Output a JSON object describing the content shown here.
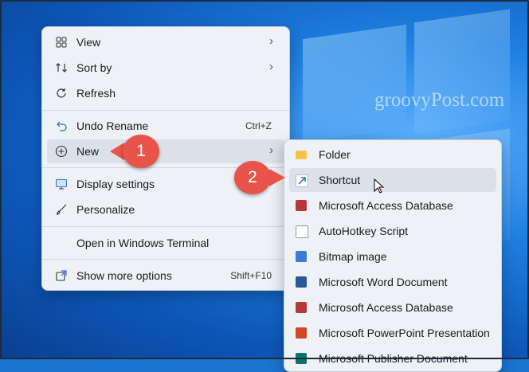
{
  "watermark": "groovyPost.com",
  "context_menu": {
    "items": [
      {
        "label": "View",
        "icon": "grid-icon",
        "chevron": "›"
      },
      {
        "label": "Sort by",
        "icon": "sort-icon",
        "chevron": "›"
      },
      {
        "label": "Refresh",
        "icon": "refresh-icon"
      },
      {
        "label": "Undo Rename",
        "icon": "undo-icon",
        "shortcut": "Ctrl+Z"
      },
      {
        "label": "New",
        "icon": "add-circle-icon",
        "chevron": "›",
        "highlighted": true
      },
      {
        "label": "Display settings",
        "icon": "display-icon"
      },
      {
        "label": "Personalize",
        "icon": "brush-icon"
      },
      {
        "label": "Open in Windows Terminal",
        "icon": ""
      },
      {
        "label": "Show more options",
        "icon": "share-icon",
        "shortcut": "Shift+F10"
      }
    ]
  },
  "submenu": {
    "items": [
      {
        "label": "Folder",
        "icon": "folder-icon",
        "color": "#f4c34a"
      },
      {
        "label": "Shortcut",
        "icon": "shortcut-icon",
        "color": "#2f6fd6",
        "highlighted": true
      },
      {
        "label": "Microsoft Access Database",
        "icon": "access-icon",
        "color": "#b7383a"
      },
      {
        "label": "AutoHotkey Script",
        "icon": "autohotkey-icon",
        "color": "#6a8f3f"
      },
      {
        "label": "Bitmap image",
        "icon": "bitmap-icon",
        "color": "#3a7bd5"
      },
      {
        "label": "Microsoft Word Document",
        "icon": "word-icon",
        "color": "#2b5797"
      },
      {
        "label": "Microsoft Access Database",
        "icon": "access-icon",
        "color": "#b7383a"
      },
      {
        "label": "Microsoft PowerPoint Presentation",
        "icon": "powerpoint-icon",
        "color": "#d24726"
      },
      {
        "label": "Microsoft Publisher Document",
        "icon": "publisher-icon",
        "color": "#077568"
      }
    ]
  },
  "callouts": [
    "1",
    "2"
  ],
  "colors": {
    "accent": "#e8534a",
    "menu_bg": "#eef1f6",
    "highlight": "#dbe1ea"
  }
}
